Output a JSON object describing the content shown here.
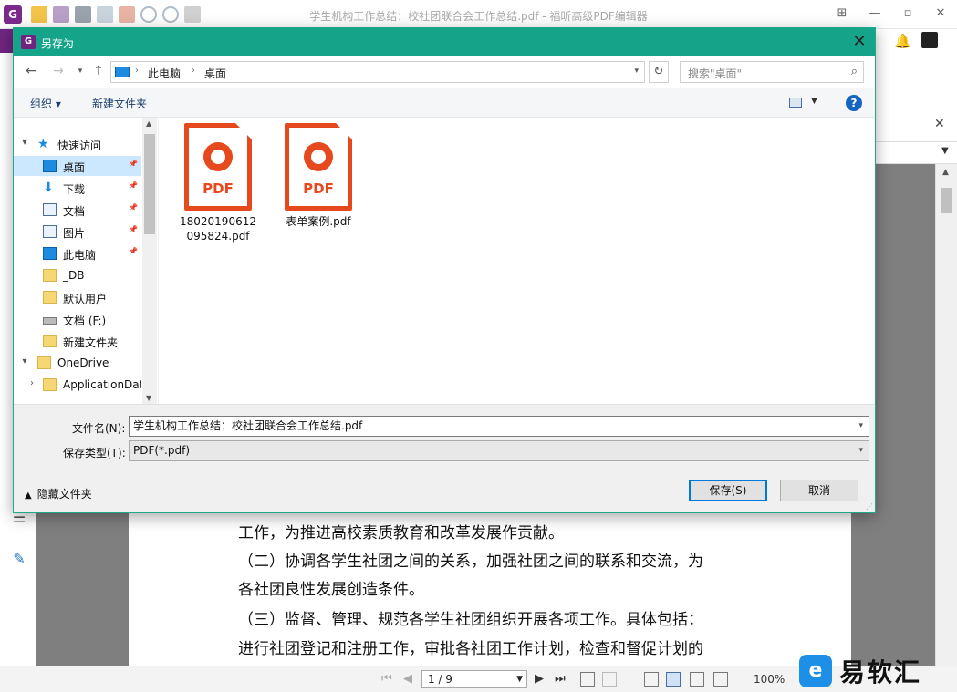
{
  "app": {
    "title": "学生机构工作总结：校社团联合会工作总结.pdf - 福昕高级PDF编辑器",
    "logo_letter": "G"
  },
  "dialog": {
    "title": "另存为",
    "close_glyph": "✕",
    "address": {
      "crumbs": [
        "此电脑",
        "桌面"
      ]
    },
    "search": {
      "placeholder": "搜索\"桌面\""
    },
    "commands": {
      "organize": "组织 ▾",
      "new_folder": "新建文件夹"
    },
    "help_glyph": "?",
    "nav_tree": [
      {
        "label": "快速访问",
        "icon": "star-icon",
        "expander": "▾",
        "selected": false,
        "pinned": false,
        "indent": 0
      },
      {
        "label": "桌面",
        "icon": "desktop-icon",
        "expander": "",
        "selected": true,
        "pinned": true,
        "indent": 1
      },
      {
        "label": "下载",
        "icon": "download-icon",
        "expander": "",
        "selected": false,
        "pinned": true,
        "indent": 1
      },
      {
        "label": "文档",
        "icon": "document-icon",
        "expander": "",
        "selected": false,
        "pinned": true,
        "indent": 1
      },
      {
        "label": "图片",
        "icon": "pictures-icon",
        "expander": "",
        "selected": false,
        "pinned": true,
        "indent": 1
      },
      {
        "label": "此电脑",
        "icon": "computer-icon",
        "expander": "",
        "selected": false,
        "pinned": true,
        "indent": 1
      },
      {
        "label": "_DB",
        "icon": "folder-icon",
        "expander": "",
        "selected": false,
        "pinned": false,
        "indent": 1
      },
      {
        "label": "默认用户",
        "icon": "folder-icon",
        "expander": "",
        "selected": false,
        "pinned": false,
        "indent": 1
      },
      {
        "label": "文档 (F:)",
        "icon": "drive-icon",
        "expander": "",
        "selected": false,
        "pinned": false,
        "indent": 1
      },
      {
        "label": "新建文件夹",
        "icon": "folder-icon",
        "expander": "",
        "selected": false,
        "pinned": false,
        "indent": 1
      },
      {
        "label": "OneDrive",
        "icon": "folder-icon",
        "expander": "▾",
        "selected": false,
        "pinned": false,
        "indent": 0
      },
      {
        "label": "ApplicationDat",
        "icon": "folder-icon",
        "expander": "›",
        "selected": false,
        "pinned": false,
        "indent": 1
      }
    ],
    "files": [
      {
        "name": "18020190612095824.pdf",
        "icon_label": "PDF"
      },
      {
        "name": "表单案例.pdf",
        "icon_label": "PDF"
      }
    ],
    "form": {
      "filename_label": "文件名(N):",
      "filename_value": "学生机构工作总结：校社团联合会工作总结.pdf",
      "filetype_label": "保存类型(T):",
      "filetype_value": "PDF(*.pdf)",
      "hide_folders": "隐藏文件夹",
      "save_button": "保存(S)",
      "cancel_button": "取消"
    }
  },
  "document": {
    "lines": [
      "工作，为推进高校素质教育和改革发展作贡献。",
      "（二）协调各学生社团之间的关系，加强社团之间的联系和交流，为",
      "各社团良性发展创造条件。",
      "（三）监督、管理、规范各学生社团组织开展各项工作。具体包括：",
      "进行社团登记和注册工作，审批各社团工作计划，检查和督促计划的"
    ]
  },
  "statusbar": {
    "page": "1 / 9",
    "zoom": "100%"
  },
  "watermark": {
    "text": "易软汇",
    "logo_letter": "e"
  },
  "colors": {
    "dialog_title": "#15a489",
    "accent_purple": "#6f2580",
    "pdf_orange": "#e6491d",
    "selection": "#cce8ff",
    "primary_button_border": "#0078d7"
  }
}
